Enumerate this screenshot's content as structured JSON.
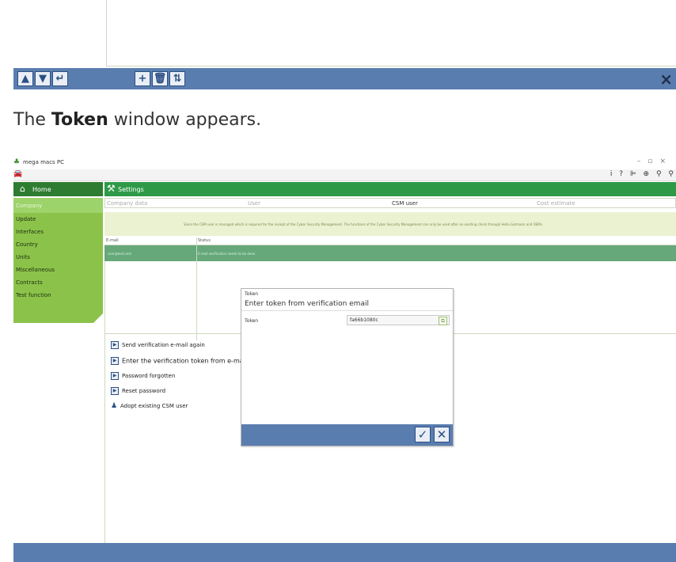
{
  "top_toolbar": {
    "buttons": [
      "▲",
      "▼",
      "↵",
      "+",
      "🗑",
      "⇅"
    ],
    "close": "×"
  },
  "caption": {
    "pre": "The ",
    "bold": "Token",
    "post": " window appears."
  },
  "app": {
    "title": "mega macs PC",
    "home_label": "Home",
    "settings_label": "Settings",
    "sidebar_items": [
      "Company",
      "Update",
      "Interfaces",
      "Country",
      "Units",
      "Miscellaneous",
      "Contracts",
      "Test function"
    ],
    "tabs": [
      "Company data",
      "User",
      "CSM user",
      "Cost estimate"
    ],
    "info_banner": "Since the CSM user is managed which is required for the receipt of the Cyber Security Management. The functions of the Cyber Security Management can only be used after an existing check through Hella Gutmann and OEMs.",
    "table_headers": [
      "E-mail",
      "Status"
    ],
    "table_row": [
      "user@test.com",
      "E-mail verification needs to be done"
    ],
    "actions": [
      "Send verification e-mail again",
      "Enter the verification token from e-mail",
      "Password forgotten",
      "Reset password",
      "Adopt existing CSM user"
    ],
    "tray_icons": "i ? ⊫ ⊕ ⚲ ⚲"
  },
  "dialog": {
    "title": "Token",
    "subtitle": "Enter token from verification email",
    "token_label": "Token",
    "token_value": "fa66b1080c",
    "ok": "✓",
    "cancel": "✕"
  }
}
